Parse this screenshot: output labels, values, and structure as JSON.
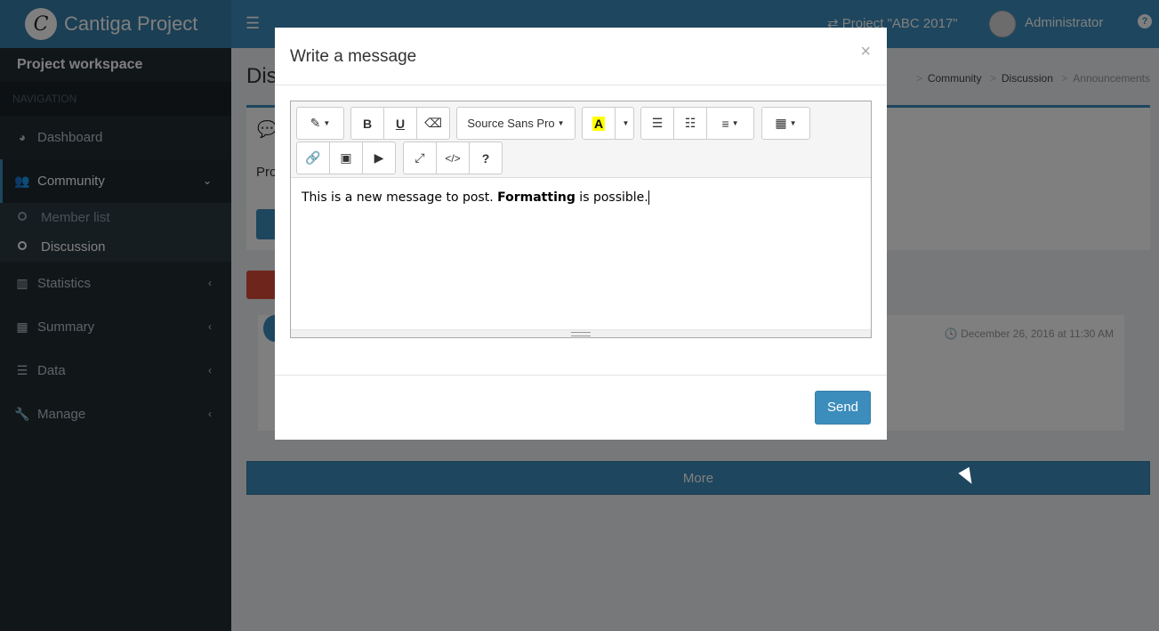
{
  "header": {
    "app_name": "Cantiga Project",
    "logo_letter": "C",
    "project_switch": "⇄ Project \"ABC 2017\"",
    "user_name": "Administrator",
    "help": "?"
  },
  "sidebar": {
    "workspace_title": "Project workspace",
    "nav_header": "NAVIGATION",
    "items": [
      {
        "label": "Dashboard",
        "icon": "dashboard-icon"
      },
      {
        "label": "Community",
        "icon": "users-icon",
        "expanded": true
      },
      {
        "label": "Statistics",
        "icon": "bar-chart-icon"
      },
      {
        "label": "Summary",
        "icon": "table-icon"
      },
      {
        "label": "Data",
        "icon": "database-icon"
      },
      {
        "label": "Manage",
        "icon": "wrench-icon"
      }
    ],
    "community_sub": [
      "Member list",
      "Discussion"
    ]
  },
  "content": {
    "page_title": "Dis",
    "breadcrumb": [
      "Community",
      "Discussion",
      "Announcements"
    ],
    "box_text": "Pro",
    "message_date": "December 26, 2016 at 11:30 AM",
    "more_label": "More"
  },
  "modal": {
    "title": "Write a message",
    "close": "×",
    "font_name": "Source Sans Pro",
    "body_before": "This is a new message to post. ",
    "body_bold": "Formatting",
    "body_after": " is possible.",
    "send_label": "Send"
  },
  "colors": {
    "brand": "#3c8dbc",
    "sidebar": "#222d32",
    "badge": "#dd4b39"
  }
}
